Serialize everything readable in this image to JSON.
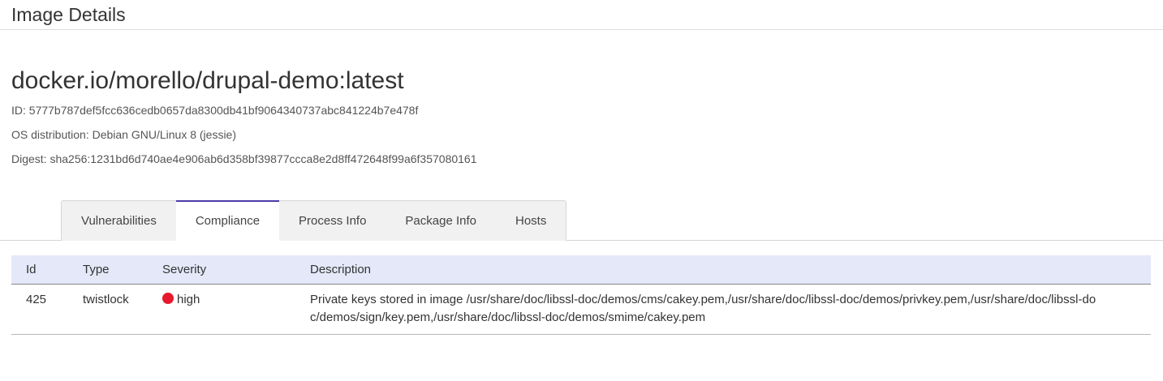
{
  "header": {
    "title": "Image Details"
  },
  "image": {
    "name": "docker.io/morello/drupal-demo:latest",
    "id_line": "ID: 5777b787def5fcc636cedb0657da8300db41bf9064340737abc841224b7e478f",
    "os_line": "OS distribution: Debian GNU/Linux 8 (jessie)",
    "digest_line": "Digest: sha256:1231bd6d740ae4e906ab6d358bf39877ccca8e2d8ff472648f99a6f357080161"
  },
  "tabs": [
    {
      "label": "Vulnerabilities",
      "active": false
    },
    {
      "label": "Compliance",
      "active": true
    },
    {
      "label": "Process Info",
      "active": false
    },
    {
      "label": "Package Info",
      "active": false
    },
    {
      "label": "Hosts",
      "active": false
    }
  ],
  "table": {
    "columns": [
      "Id",
      "Type",
      "Severity",
      "Description"
    ],
    "rows": [
      {
        "id": "425",
        "type": "twistlock",
        "severity": "high",
        "severity_color": "#e8192c",
        "description": "Private keys stored in image /usr/share/doc/libssl-doc/demos/cms/cakey.pem,/usr/share/doc/libssl-doc/demos/privkey.pem,/usr/share/doc/libssl-doc/demos/sign/key.pem,/usr/share/doc/libssl-doc/demos/smime/cakey.pem"
      }
    ]
  },
  "colors": {
    "accent": "#4b3ba8",
    "table_header_bg": "#e4e8f8",
    "severity_high": "#e8192c"
  }
}
